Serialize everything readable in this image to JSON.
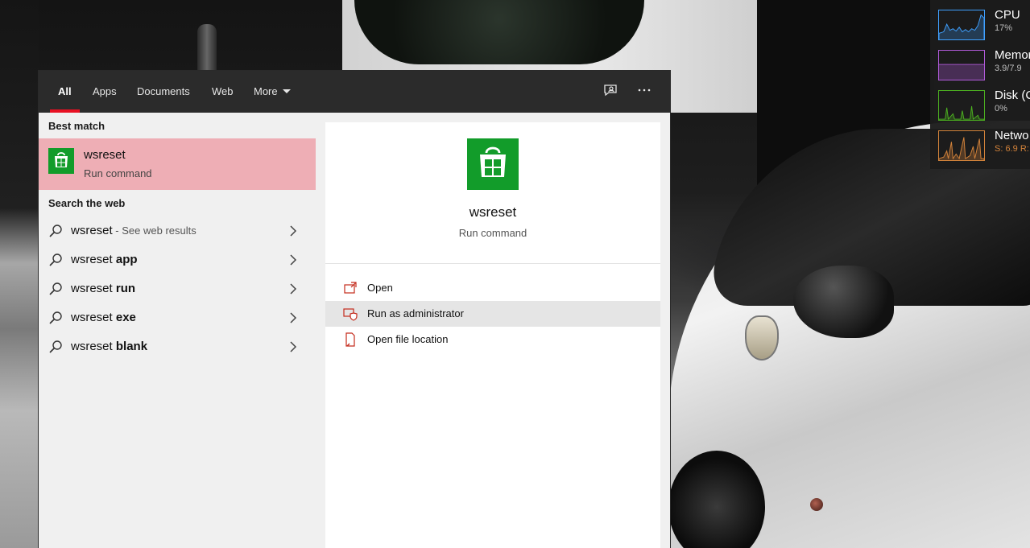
{
  "taskbar_widget": {
    "items": [
      {
        "name": "CPU",
        "value": "17%",
        "color": "#3fa0ff"
      },
      {
        "name": "Memory",
        "value": "3.9/7.9",
        "color": "#b05ad9"
      },
      {
        "name": "Disk (C",
        "value": "0%",
        "color": "#4caf20"
      },
      {
        "name": "Netwo",
        "value_s": "S: 6.9",
        "value_r": "R:",
        "color": "#d2823a"
      }
    ]
  },
  "search": {
    "tabs": [
      {
        "label": "All",
        "active": true
      },
      {
        "label": "Apps"
      },
      {
        "label": "Documents"
      },
      {
        "label": "Web"
      },
      {
        "label": "More"
      }
    ],
    "best_match": {
      "heading": "Best match",
      "title": "wsreset",
      "subtitle": "Run command"
    },
    "web": {
      "heading": "Search the web",
      "suggestions": [
        {
          "prefix": "wsreset",
          "bold": "",
          "hint": " - See web results"
        },
        {
          "prefix": "wsreset ",
          "bold": "app",
          "hint": ""
        },
        {
          "prefix": "wsreset ",
          "bold": "run",
          "hint": ""
        },
        {
          "prefix": "wsreset ",
          "bold": "exe",
          "hint": ""
        },
        {
          "prefix": "wsreset ",
          "bold": "blank",
          "hint": ""
        }
      ]
    },
    "detail": {
      "title": "wsreset",
      "subtitle": "Run command",
      "actions": [
        {
          "label": "Open",
          "icon": "open-icon"
        },
        {
          "label": "Run as administrator",
          "icon": "shield-icon"
        },
        {
          "label": "Open file location",
          "icon": "file-location-icon"
        }
      ]
    }
  },
  "colors": {
    "accent": "#e81123",
    "store_green": "#129c2a",
    "selection": "#eeaeb5",
    "topbar": "#2b2b2b"
  }
}
